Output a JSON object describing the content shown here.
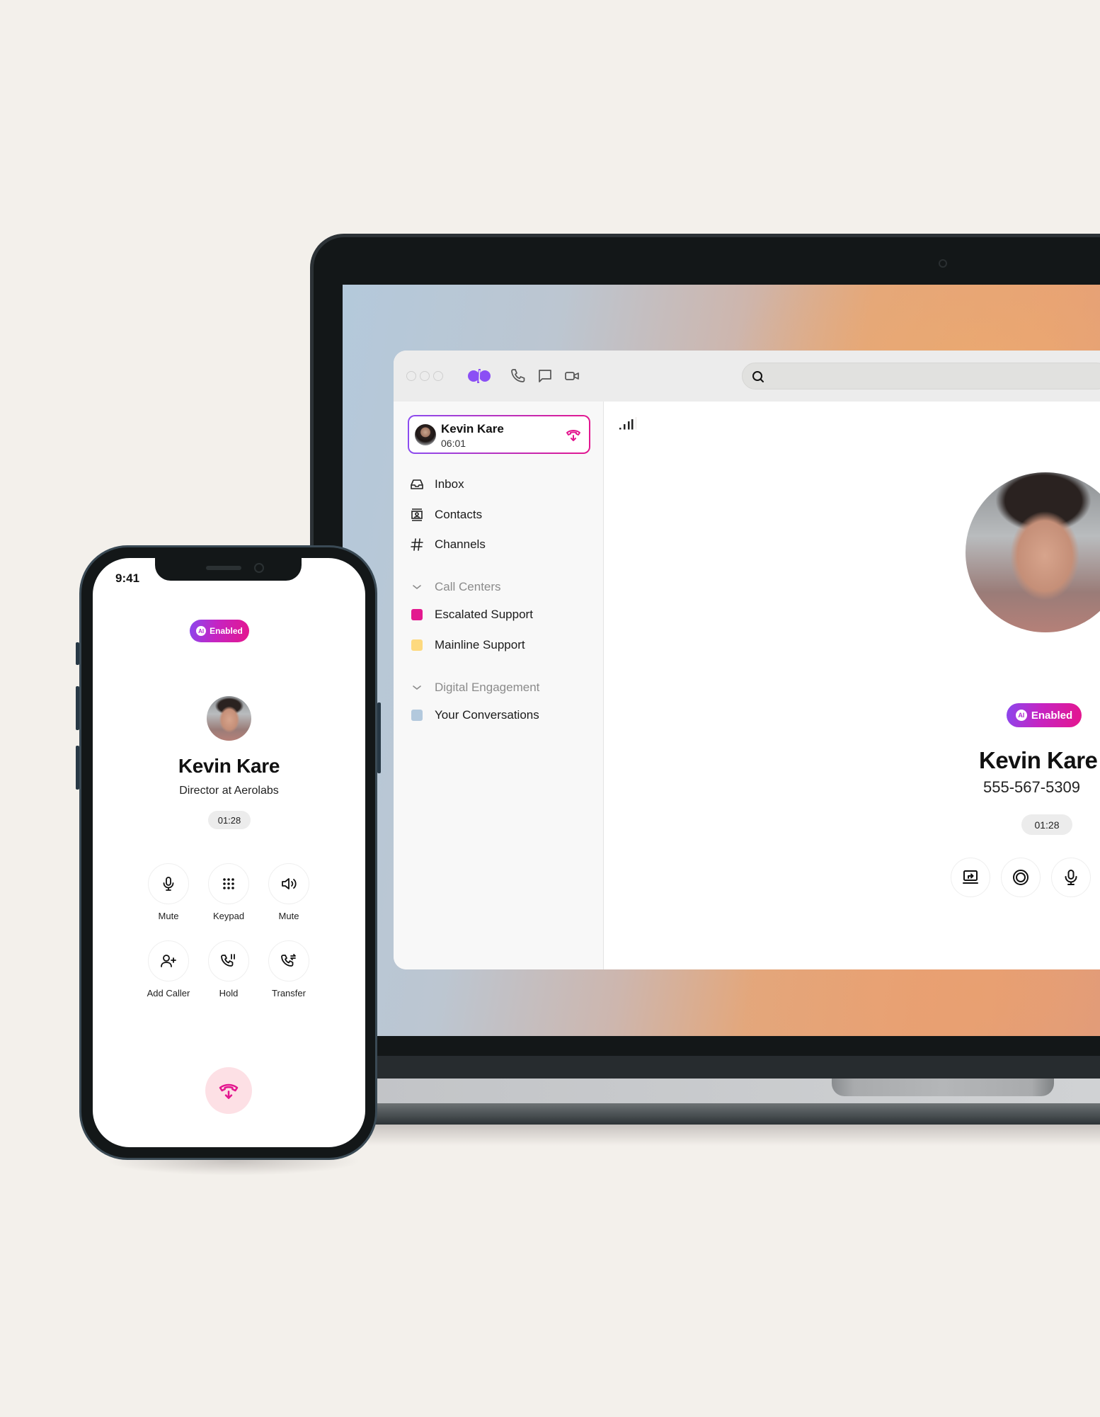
{
  "desktop_app": {
    "window_controls": [
      "close",
      "minimize",
      "maximize"
    ],
    "logo": "dialpad-logo",
    "toolbar_icons": [
      "phone-icon",
      "chat-icon",
      "video-icon"
    ],
    "search": {
      "placeholder": "",
      "value": ""
    },
    "active_call": {
      "name": "Kevin Kare",
      "duration": "06:01",
      "action": "hang-up"
    },
    "nav": [
      {
        "label": "Inbox",
        "icon": "inbox-icon"
      },
      {
        "label": "Contacts",
        "icon": "contacts-icon"
      },
      {
        "label": "Channels",
        "icon": "hash-icon"
      }
    ],
    "sections": [
      {
        "title": "Call Centers",
        "items": [
          {
            "label": "Escalated Support",
            "color": "#e3198f"
          },
          {
            "label": "Mainline Support",
            "color": "#fdd97e"
          }
        ]
      },
      {
        "title": "Digital Engagement",
        "items": [
          {
            "label": "Your Conversations",
            "color": "#b3c9dd"
          }
        ]
      }
    ],
    "call_panel": {
      "badge": {
        "icon": "ai-icon",
        "text": "AI",
        "label": "Enabled"
      },
      "name": "Kevin Kare",
      "phone": "555-567-5309",
      "timer": "01:28",
      "actions": [
        "share-screen",
        "record",
        "mute"
      ]
    }
  },
  "phone_app": {
    "status_time": "9:41",
    "badge": {
      "text": "AI",
      "label": "Enabled"
    },
    "name": "Kevin Kare",
    "title": "Director at Aerolabs",
    "timer": "01:28",
    "actions": [
      {
        "label": "Mute",
        "icon": "microphone-icon"
      },
      {
        "label": "Keypad",
        "icon": "keypad-icon"
      },
      {
        "label": "Mute",
        "icon": "speaker-icon"
      },
      {
        "label": "Add Caller",
        "icon": "add-user-icon"
      },
      {
        "label": "Hold",
        "icon": "hold-icon"
      },
      {
        "label": "Transfer",
        "icon": "transfer-icon"
      }
    ],
    "hangup": "hang-up"
  },
  "colors": {
    "accent_purple": "#8b4cf0",
    "accent_pink": "#e3178f",
    "hangup_bg": "#fde0e5",
    "background": "#f3f0eb"
  }
}
